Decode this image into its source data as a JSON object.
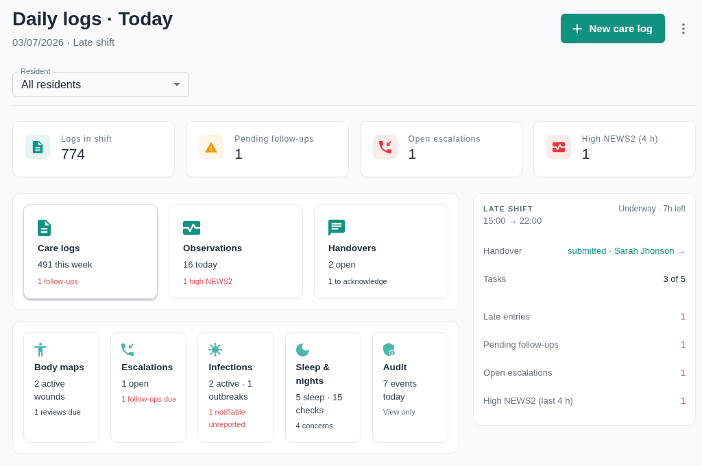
{
  "header": {
    "title": "Daily logs · Today",
    "subtitle": "03/07/2026 · Late shift",
    "new_button": "New care log"
  },
  "filter": {
    "label": "Resident",
    "value": "All residents"
  },
  "stats": [
    {
      "label": "Logs in shift",
      "value": "774",
      "color": "#0f9488"
    },
    {
      "label": "Pending follow-ups",
      "value": "1",
      "color": "#f59e0b"
    },
    {
      "label": "Open escalations",
      "value": "1",
      "color": "#e5383b"
    },
    {
      "label": "High NEWS2 (4 h)",
      "value": "1",
      "color": "#e5383b"
    }
  ],
  "main_modules": [
    {
      "title": "Care logs",
      "summary": "491 this week",
      "note": "1 follow-ups",
      "kind": "alert",
      "selected": true
    },
    {
      "title": "Observations",
      "summary": "16 today",
      "note": "1 high NEWS2",
      "kind": "alert",
      "selected": false
    },
    {
      "title": "Handovers",
      "summary": "2 open",
      "note": "1 to acknowledge",
      "kind": "neutral",
      "selected": false
    }
  ],
  "more_modules": [
    {
      "title": "Body maps",
      "summary": "2 active wounds",
      "note": "1 reviews due",
      "kind": "neutral",
      "selected": false
    },
    {
      "title": "Escalations",
      "summary": "1 open",
      "note": "1 follow-ups due",
      "kind": "alert",
      "selected": false
    },
    {
      "title": "Infections",
      "summary": "2 active · 1 outbreaks",
      "note": "1 notifiable unreported",
      "kind": "alert",
      "selected": false
    },
    {
      "title": "Sleep & nights",
      "summary": "5 sleep · 15 checks",
      "note": "4 concerns",
      "kind": "neutral",
      "selected": false
    },
    {
      "title": "Audit",
      "summary": "7 events today",
      "note": "View only",
      "kind": "muted",
      "selected": false
    }
  ],
  "shift": {
    "title": "LATE SHIFT",
    "time": "15:00 → 22:00",
    "status": "Underway · 7h left",
    "details": [
      {
        "label": "Handover",
        "value": "submitted · Sarah Jhonson →",
        "kind": "link"
      },
      {
        "label": "Tasks",
        "value": "3 of 5",
        "kind": "text"
      }
    ],
    "counts": [
      {
        "label": "Late entries",
        "value": "1",
        "alert": true
      },
      {
        "label": "Pending follow-ups",
        "value": "1",
        "alert": true
      },
      {
        "label": "Open escalations",
        "value": "1",
        "alert": true
      },
      {
        "label": "High NEWS2 (last 4 h)",
        "value": "1",
        "alert": true
      }
    ]
  }
}
